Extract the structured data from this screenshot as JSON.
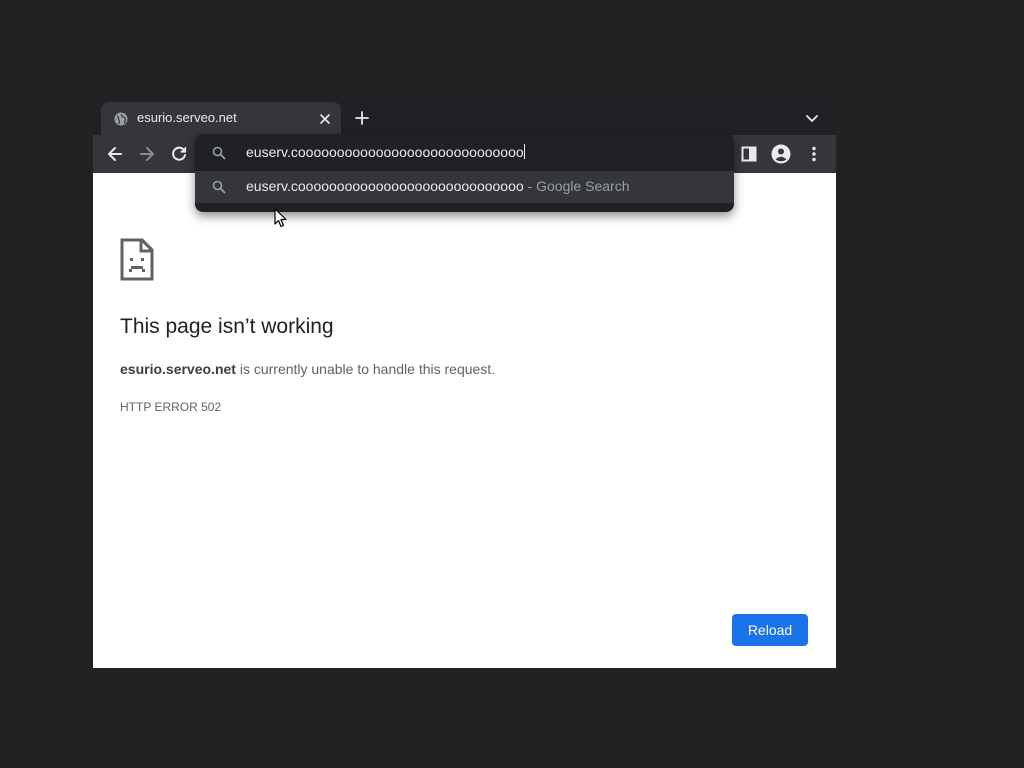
{
  "tab": {
    "title": "esurio.serveo.net",
    "favicon": "globe-icon",
    "close_icon": "close-icon"
  },
  "tabstrip": {
    "new_tab_icon": "plus-icon",
    "tab_search_icon": "chevron-down-icon"
  },
  "toolbar": {
    "back_icon": "arrow-left-icon",
    "forward_icon": "arrow-right-icon",
    "reload_icon": "reload-icon",
    "side_panel_icon": "side-panel-icon",
    "profile_icon": "account-circle-icon",
    "menu_icon": "more-vert-icon"
  },
  "omnibox": {
    "input_value": "euserv.cooooooooooooooooooooooooooooo",
    "suggestion_query": "euserv.cooooooooooooooooooooooooooooo",
    "suggestion_suffix": " - Google Search",
    "icon": "search-icon"
  },
  "error_page": {
    "icon": "sad-page-icon",
    "title": "This page isn’t working",
    "host": "esurio.serveo.net",
    "description": " is currently unable to handle this request.",
    "code": "HTTP ERROR 502",
    "reload_label": "Reload"
  },
  "colors": {
    "accent": "#1a73e8",
    "toolbar": "#35363a",
    "tabstrip": "#202124",
    "desktop": "#212221"
  }
}
